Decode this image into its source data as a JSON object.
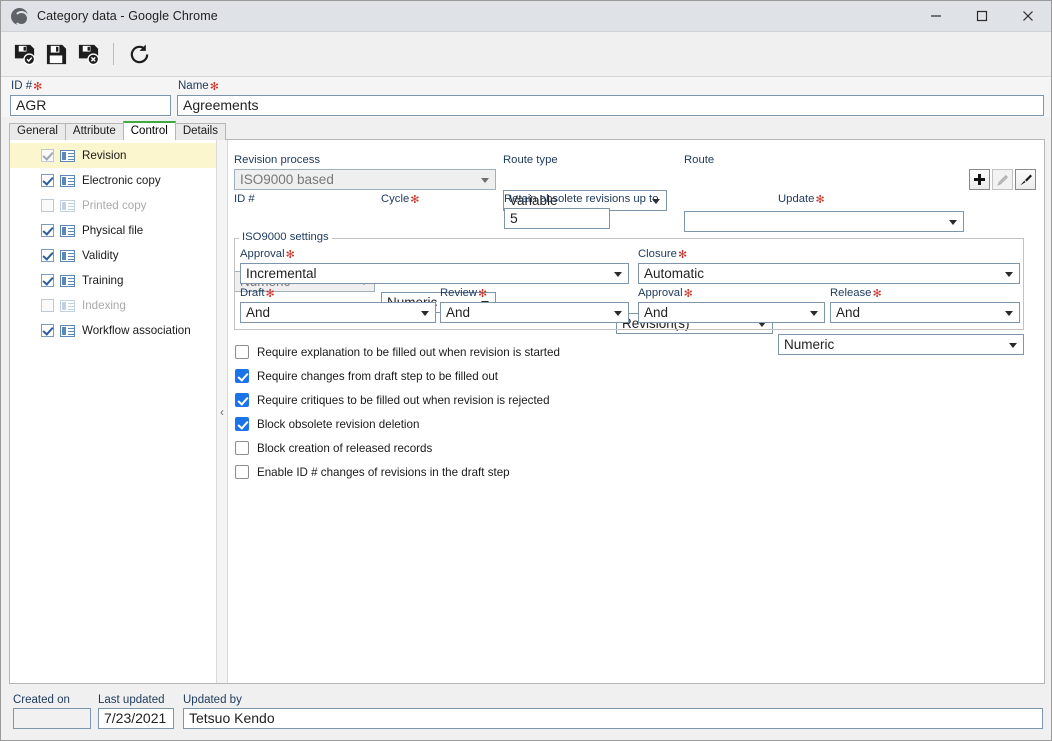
{
  "window": {
    "title": "Category data - Google Chrome",
    "favicon": "globe-icon",
    "minimize": "–",
    "maximize": "□",
    "close": "✕"
  },
  "toolbar": {
    "buttons": [
      {
        "name": "save-and-new-button",
        "icon": "floppy-plus-icon"
      },
      {
        "name": "save-button",
        "icon": "floppy-icon"
      },
      {
        "name": "save-and-close-button",
        "icon": "floppy-close-icon"
      },
      {
        "name": "refresh-button",
        "icon": "refresh-icon"
      }
    ]
  },
  "header": {
    "id_label": "ID #",
    "id_value": "AGR",
    "name_label": "Name",
    "name_value": "Agreements",
    "required_marker": "✻"
  },
  "tabs": [
    {
      "label": "General",
      "active": false
    },
    {
      "label": "Attribute",
      "active": false
    },
    {
      "label": "Control",
      "active": true
    },
    {
      "label": "Details",
      "active": false
    }
  ],
  "sidebar": {
    "items": [
      {
        "label": "Revision",
        "checked": true,
        "enabled": false,
        "selected": true
      },
      {
        "label": "Electronic copy",
        "checked": true,
        "enabled": true,
        "selected": false
      },
      {
        "label": "Printed copy",
        "checked": false,
        "enabled": false,
        "selected": false
      },
      {
        "label": "Physical file",
        "checked": true,
        "enabled": true,
        "selected": false
      },
      {
        "label": "Validity",
        "checked": true,
        "enabled": true,
        "selected": false
      },
      {
        "label": "Training",
        "checked": true,
        "enabled": true,
        "selected": false
      },
      {
        "label": "Indexing",
        "checked": false,
        "enabled": false,
        "selected": false
      },
      {
        "label": "Workflow association",
        "checked": true,
        "enabled": true,
        "selected": false
      }
    ],
    "collapse_handle": "‹"
  },
  "form": {
    "revision_process": {
      "label": "Revision process",
      "value": "ISO9000 based",
      "readonly": true
    },
    "route_type": {
      "label": "Route type",
      "value": "Variable"
    },
    "route": {
      "label": "Route",
      "value": ""
    },
    "route_buttons": [
      {
        "name": "route-add-button",
        "icon": "plus-icon",
        "enabled": true
      },
      {
        "name": "route-edit-button",
        "icon": "pencil-icon",
        "enabled": false
      },
      {
        "name": "route-pick-button",
        "icon": "brush-icon",
        "enabled": true
      }
    ],
    "id_format": {
      "label": "ID #",
      "value": "Numeric",
      "readonly": true
    },
    "cycle": {
      "label": "Cycle",
      "value": "Numeric",
      "required": true
    },
    "retain": {
      "label": "Retain obsolete revisions up to",
      "value": "5",
      "unit": "Revision(s)"
    },
    "update": {
      "label": "Update",
      "value": "Numeric",
      "required": true
    },
    "iso_group": {
      "title": "ISO9000 settings",
      "approval_mode": {
        "label": "Approval",
        "value": "Incremental",
        "required": true
      },
      "closure": {
        "label": "Closure",
        "value": "Automatic",
        "required": true
      },
      "draft": {
        "label": "Draft",
        "value": "And",
        "required": true
      },
      "review": {
        "label": "Review",
        "value": "And",
        "required": true
      },
      "approval": {
        "label": "Approval",
        "value": "And",
        "required": true
      },
      "release": {
        "label": "Release",
        "value": "And",
        "required": true
      }
    },
    "options": [
      {
        "label": "Require explanation to be filled out when revision is started",
        "checked": false
      },
      {
        "label": "Require changes from draft step to be filled out",
        "checked": true
      },
      {
        "label": "Require critiques to be filled out when revision is rejected",
        "checked": true
      },
      {
        "label": "Block obsolete revision deletion",
        "checked": true
      },
      {
        "label": "Block creation of released records",
        "checked": false
      },
      {
        "label": "Enable ID # changes of revisions in the draft step",
        "checked": false
      }
    ]
  },
  "footer": {
    "created_label": "Created on",
    "created_value": "",
    "updated_label": "Last updated",
    "updated_value": "7/23/2021",
    "by_label": "Updated by",
    "by_value": "Tetsuo Kendo"
  },
  "colors": {
    "accent_green": "#3faa3f",
    "selected_row": "#fbf6ce",
    "checkbox_blue": "#1a73e8",
    "required_red": "#c9342a",
    "label_blue": "#1d3a5c"
  }
}
